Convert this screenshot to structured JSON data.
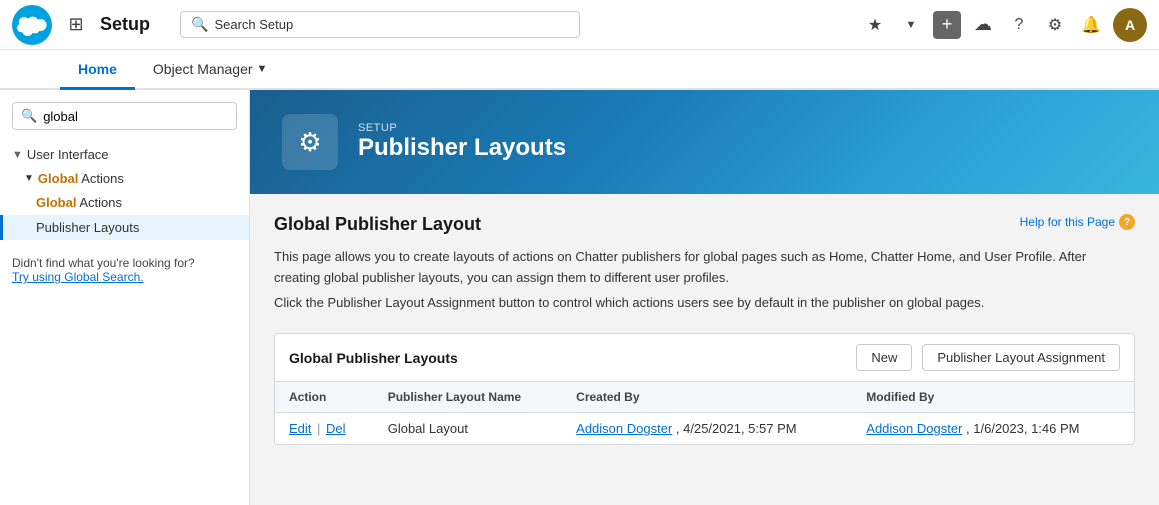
{
  "topNav": {
    "setupLabel": "Setup",
    "searchPlaceholder": "Search Setup",
    "tabs": [
      {
        "label": "Home",
        "active": true
      },
      {
        "label": "Object Manager",
        "hasChevron": true
      }
    ],
    "iconButtons": [
      "star",
      "chevron-down",
      "plus",
      "cloud",
      "help",
      "gear",
      "bell"
    ]
  },
  "sidebar": {
    "searchValue": "global",
    "searchPlaceholder": "",
    "groups": [
      {
        "label": "User Interface",
        "expanded": true,
        "subGroups": [
          {
            "label": "Global Actions",
            "expanded": true,
            "items": [
              {
                "label": "Global Actions",
                "highlightText": "Global",
                "active": false
              },
              {
                "label": "Publisher Layouts",
                "active": true
              }
            ]
          }
        ]
      }
    ],
    "notFoundText": "Didn't find what you're looking for?",
    "notFoundLink": "Try using Global Search."
  },
  "pageHeader": {
    "setupLabel": "SETUP",
    "title": "Publisher Layouts",
    "iconSymbol": "⚙"
  },
  "content": {
    "sectionTitle": "Global Publisher Layout",
    "helpLinkText": "Help for this Page",
    "description1": "This page allows you to create layouts of actions on Chatter publishers for global pages such as Home, Chatter Home, and User Profile. After creating global publisher layouts, you can assign them to different user profiles.",
    "description2": "Click the Publisher Layout Assignment button to control which actions users see by default in the publisher on global pages.",
    "table": {
      "title": "Global Publisher Layouts",
      "newButton": "New",
      "assignmentButton": "Publisher Layout Assignment",
      "columns": [
        "Action",
        "Publisher Layout Name",
        "Created By",
        "Modified By"
      ],
      "rows": [
        {
          "action": {
            "edit": "Edit",
            "sep": "|",
            "del": "Del"
          },
          "layoutName": "Global Layout",
          "createdBy": "Addison Dogster",
          "createdDate": ", 4/25/2021, 5:57 PM",
          "modifiedBy": "Addison Dogster",
          "modifiedDate": ", 1/6/2023, 1:46 PM"
        }
      ]
    }
  }
}
